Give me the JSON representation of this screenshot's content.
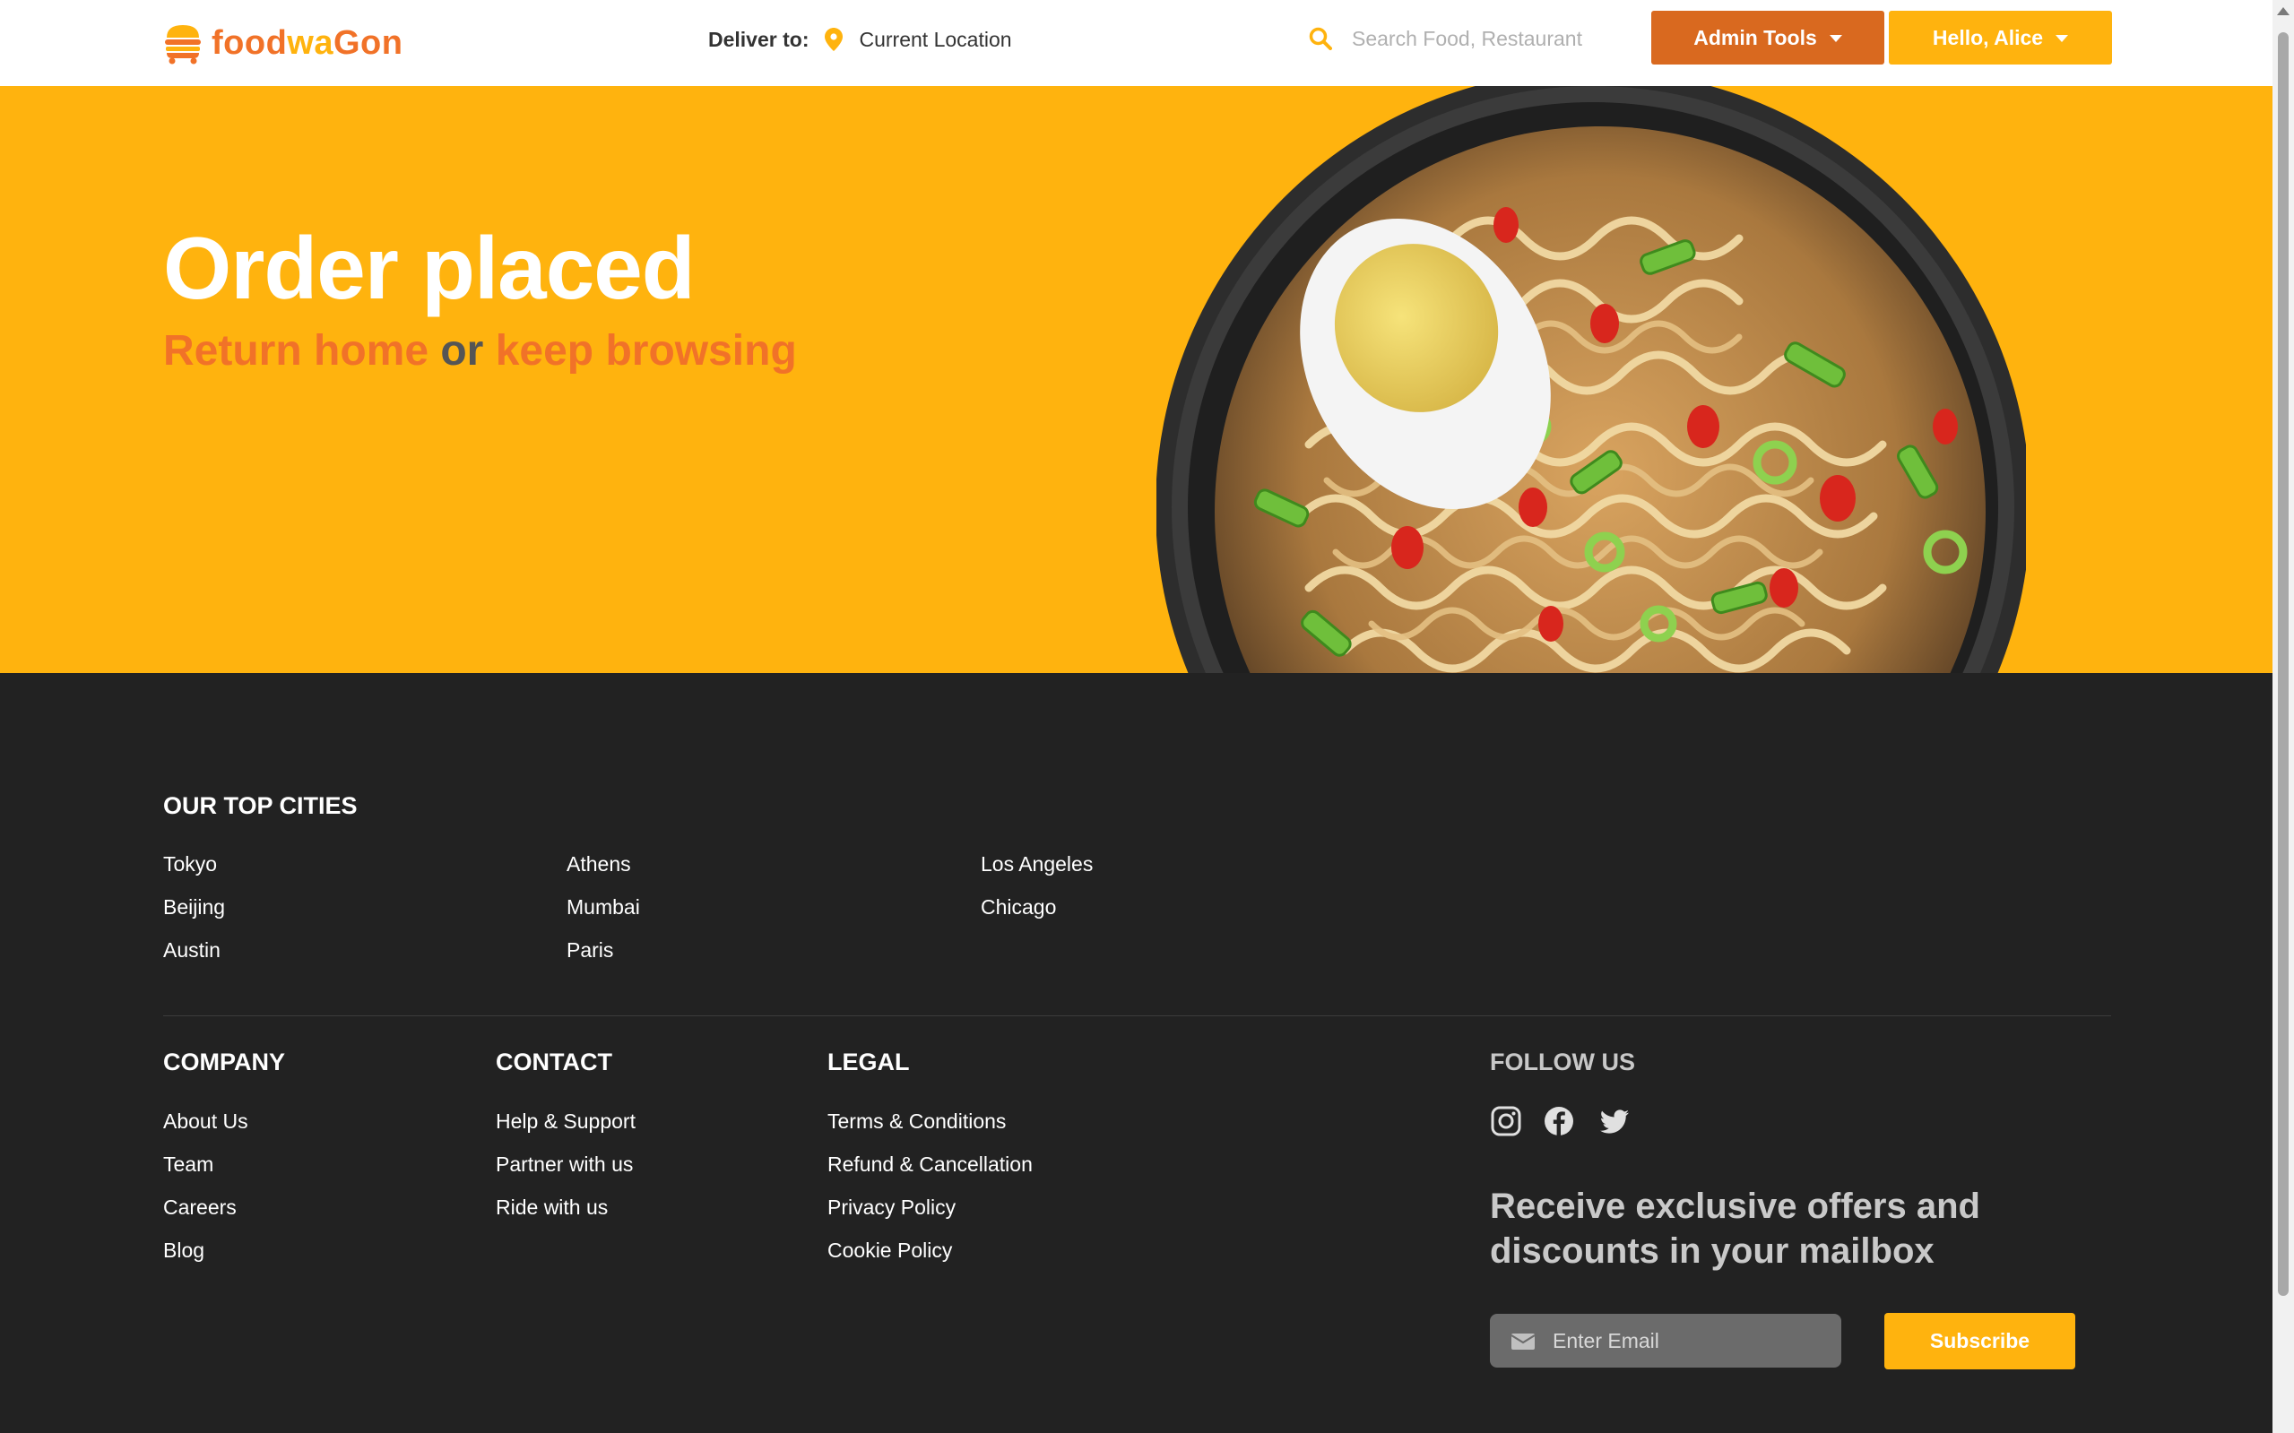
{
  "header": {
    "logo_text_1": "food",
    "logo_text_2": "wa",
    "logo_text_3": "Gon",
    "deliver_label": "Deliver to:",
    "location": "Current Location",
    "search_placeholder": "Search Food, Restaurant",
    "admin_button": "Admin Tools",
    "user_button": "Hello, Alice"
  },
  "hero": {
    "title": "Order placed",
    "link_home": "Return home",
    "or_text": "or",
    "link_browse": "keep browsing"
  },
  "footer": {
    "cities_heading": "OUR TOP CITIES",
    "cities": [
      "Tokyo",
      "Beijing",
      "Austin",
      "Athens",
      "Mumbai",
      "Paris",
      "Los Angeles",
      "Chicago"
    ],
    "company": {
      "heading": "COMPANY",
      "links": [
        "About Us",
        "Team",
        "Careers",
        "Blog"
      ]
    },
    "contact": {
      "heading": "CONTACT",
      "links": [
        "Help & Support",
        "Partner with us",
        "Ride with us"
      ]
    },
    "legal": {
      "heading": "LEGAL",
      "links": [
        "Terms & Conditions",
        "Refund & Cancellation",
        "Privacy Policy",
        "Cookie Policy"
      ]
    },
    "follow_heading": "FOLLOW US",
    "social_icons": [
      "instagram-icon",
      "facebook-icon",
      "twitter-icon"
    ],
    "newsletter_text": "Receive exclusive offers and discounts in your mailbox",
    "email_placeholder": "Enter Email",
    "subscribe_label": "Subscribe"
  },
  "colors": {
    "brand_orange": "#f17228",
    "brand_yellow": "#ffb30e",
    "admin_orange": "#d9691f",
    "footer_bg": "#222222"
  }
}
